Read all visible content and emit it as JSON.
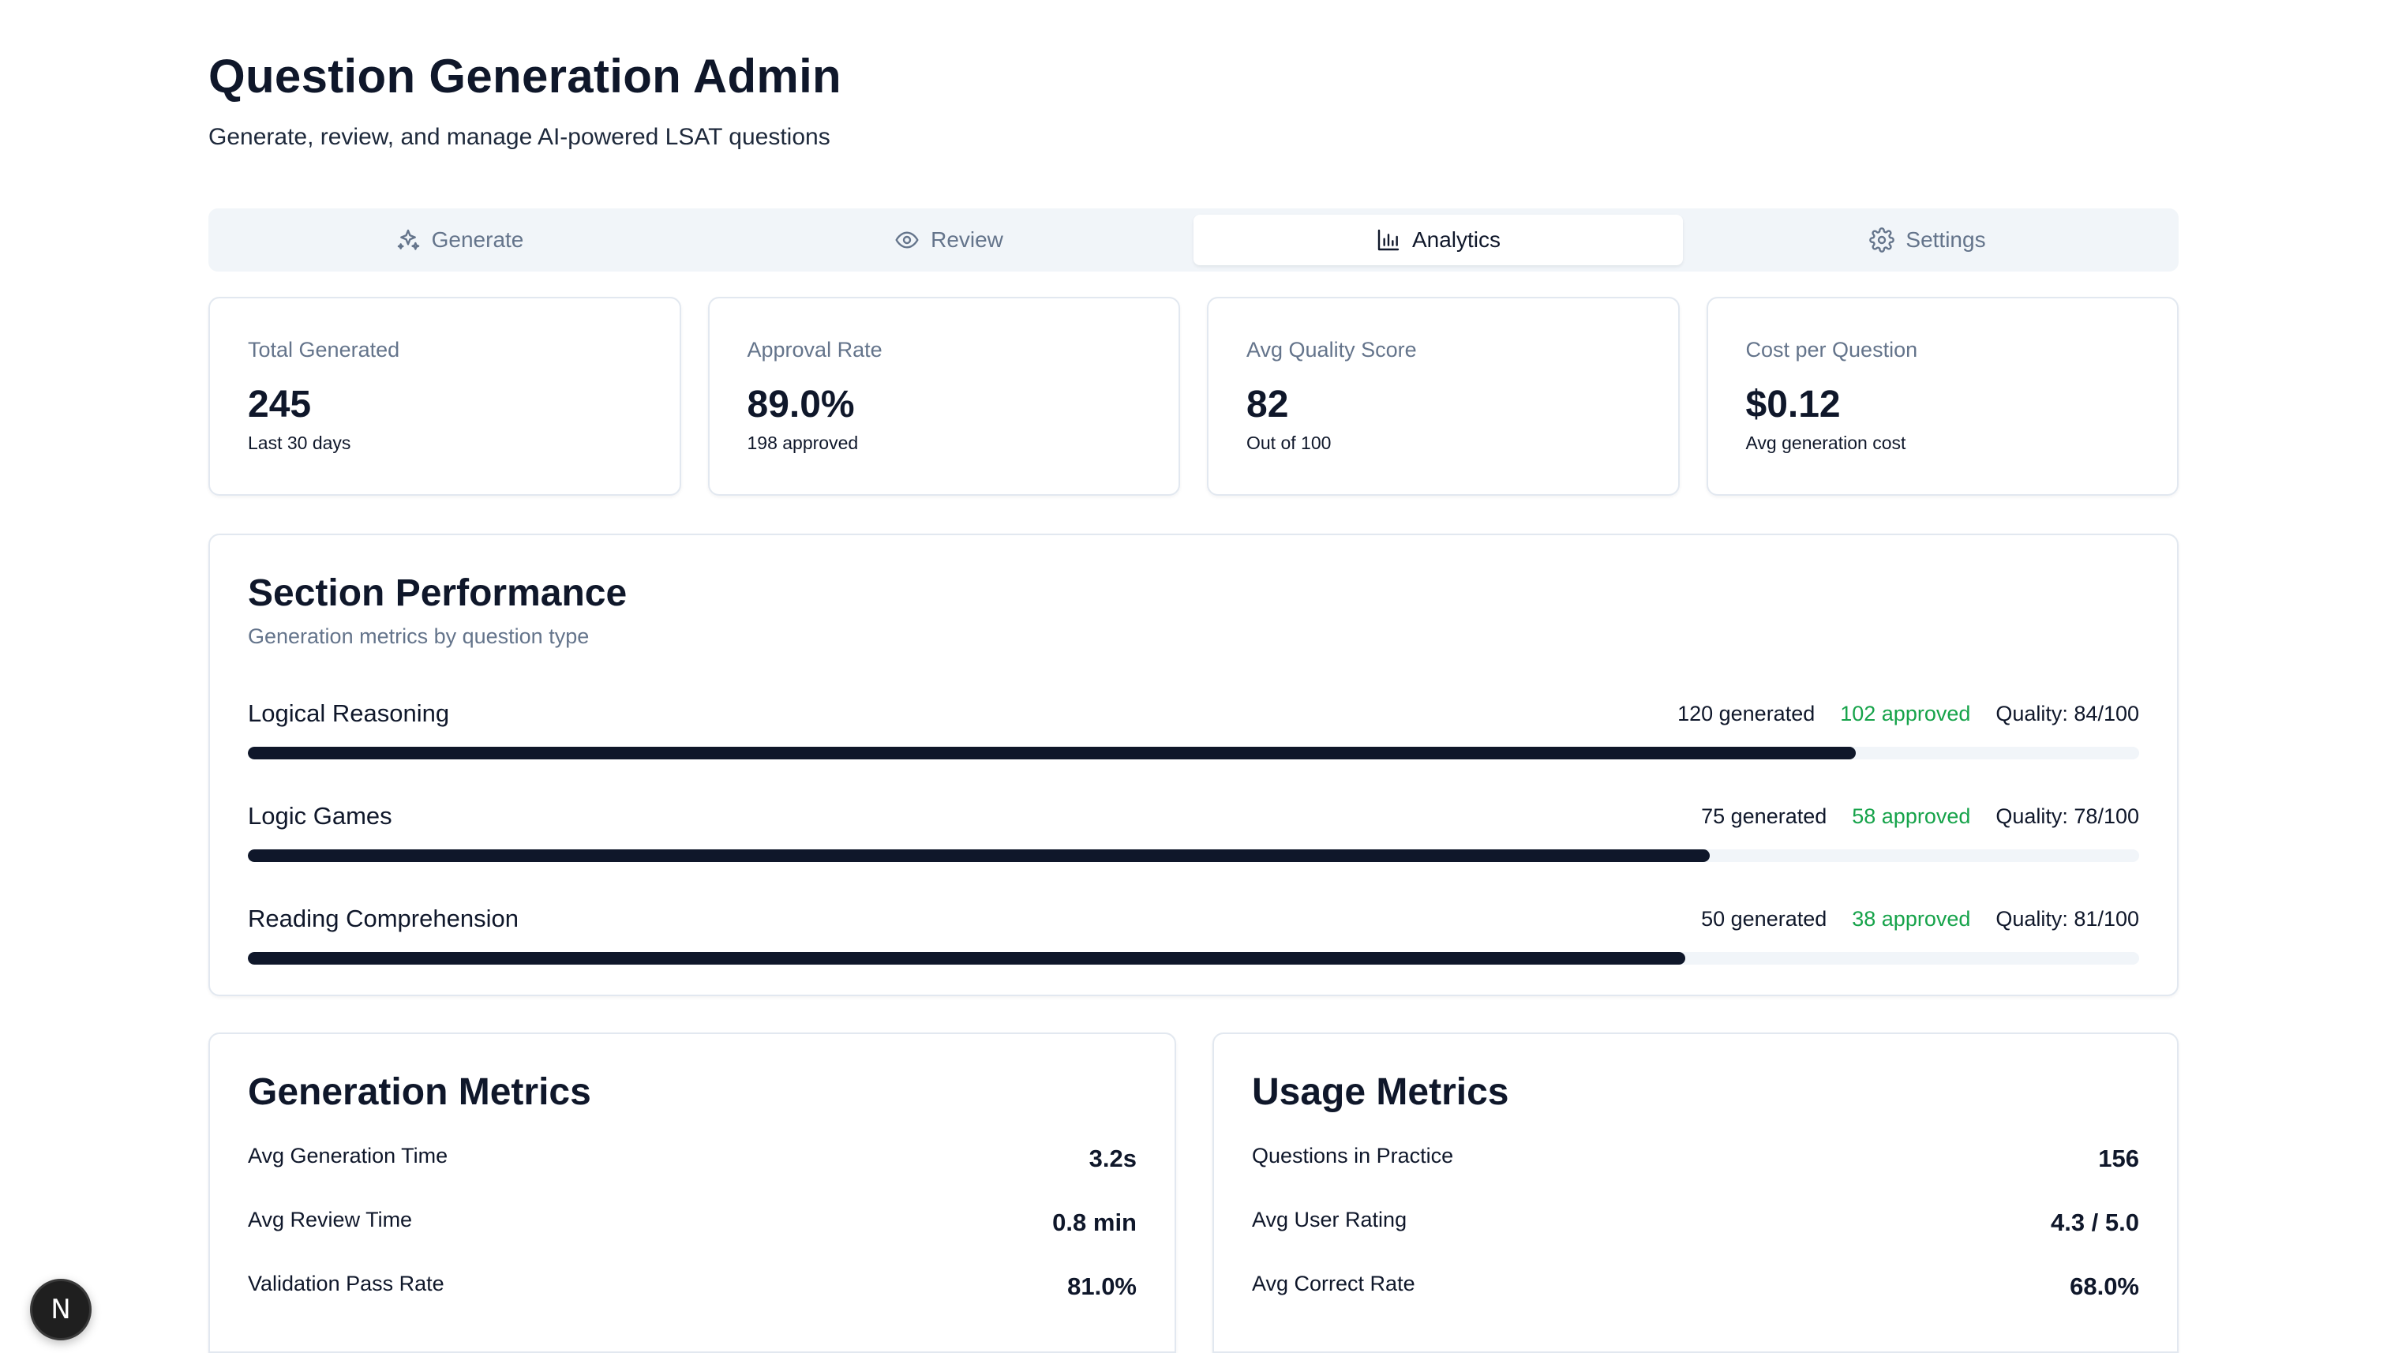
{
  "header": {
    "title": "Question Generation Admin",
    "subtitle": "Generate, review, and manage AI-powered LSAT questions"
  },
  "tabs": [
    {
      "label": "Generate",
      "icon": "sparkles-icon",
      "active": false
    },
    {
      "label": "Review",
      "icon": "eye-icon",
      "active": false
    },
    {
      "label": "Analytics",
      "icon": "bar-chart-icon",
      "active": true
    },
    {
      "label": "Settings",
      "icon": "gear-icon",
      "active": false
    }
  ],
  "stats": [
    {
      "label": "Total Generated",
      "value": "245",
      "sub": "Last 30 days"
    },
    {
      "label": "Approval Rate",
      "value": "89.0%",
      "sub": "198 approved"
    },
    {
      "label": "Avg Quality Score",
      "value": "82",
      "sub": "Out of 100"
    },
    {
      "label": "Cost per Question",
      "value": "$0.12",
      "sub": "Avg generation cost"
    }
  ],
  "section_performance": {
    "title": "Section Performance",
    "description": "Generation metrics by question type",
    "rows": [
      {
        "name": "Logical Reasoning",
        "generated": "120 generated",
        "approved": "102 approved",
        "quality": "Quality: 84/100",
        "progress": 0.85
      },
      {
        "name": "Logic Games",
        "generated": "75 generated",
        "approved": "58 approved",
        "quality": "Quality: 78/100",
        "progress": 0.773
      },
      {
        "name": "Reading Comprehension",
        "generated": "50 generated",
        "approved": "38 approved",
        "quality": "Quality: 81/100",
        "progress": 0.76
      }
    ]
  },
  "generation_metrics": {
    "title": "Generation Metrics",
    "rows": [
      {
        "label": "Avg Generation Time",
        "value": "3.2s"
      },
      {
        "label": "Avg Review Time",
        "value": "0.8 min"
      },
      {
        "label": "Validation Pass Rate",
        "value": "81.0%"
      }
    ]
  },
  "usage_metrics": {
    "title": "Usage Metrics",
    "rows": [
      {
        "label": "Questions in Practice",
        "value": "156"
      },
      {
        "label": "Avg User Rating",
        "value": "4.3 / 5.0"
      },
      {
        "label": "Avg Correct Rate",
        "value": "68.0%"
      }
    ]
  },
  "dev_badge": {
    "label": "N"
  },
  "colors": {
    "accent": "#0f172a",
    "approved": "#16a34a",
    "muted": "#64748b",
    "track": "#f1f5f9"
  }
}
